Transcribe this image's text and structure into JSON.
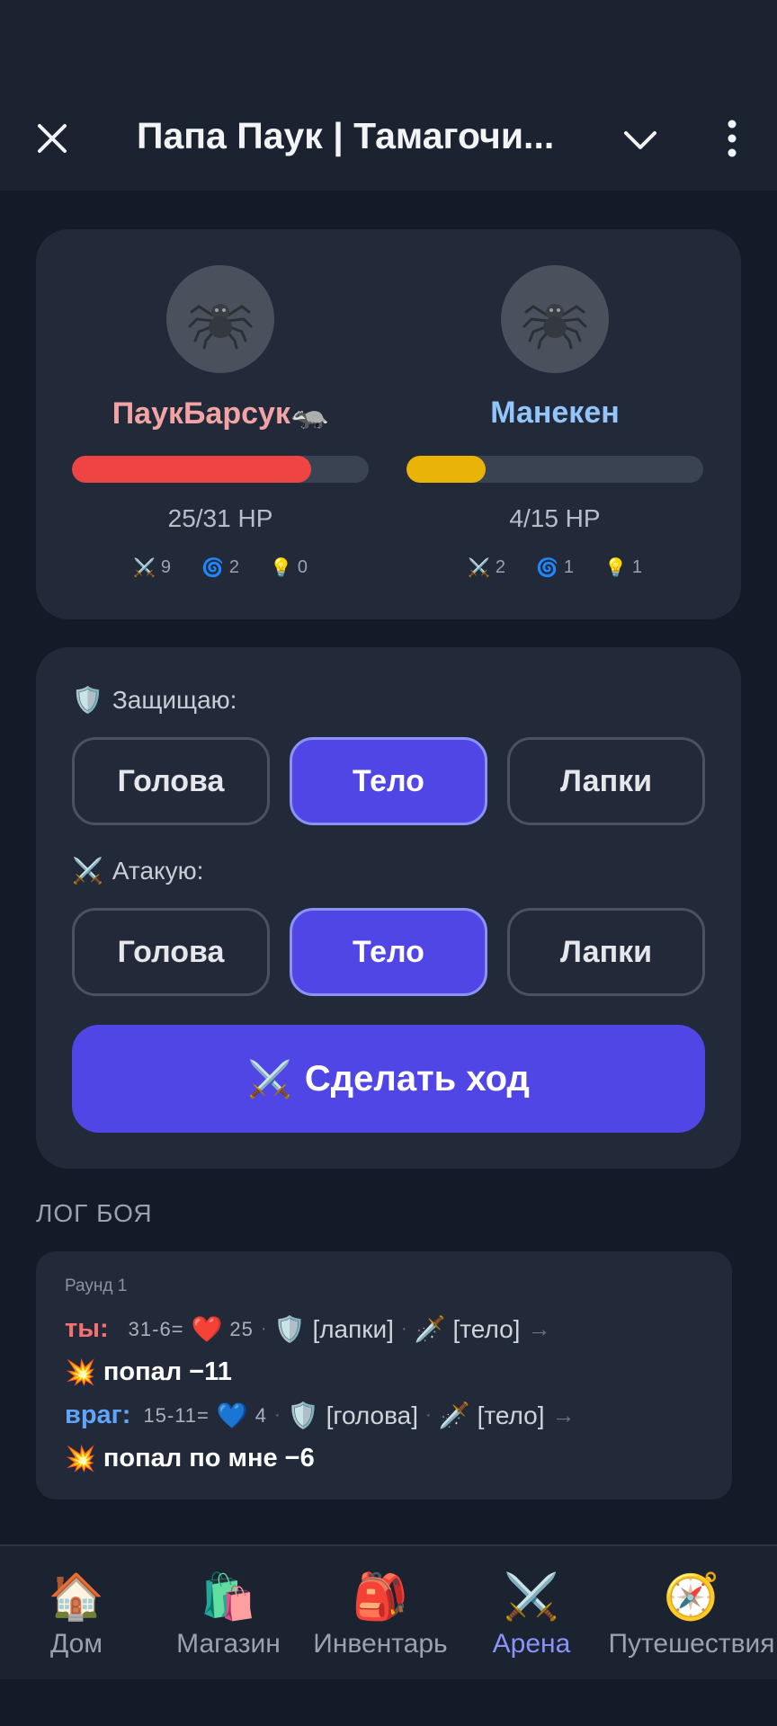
{
  "header": {
    "title": "Папа Паук | Тамагочи..."
  },
  "player": {
    "name": "ПаукБарсук🦡",
    "name_color": "#f2a3a3",
    "hp_text": "25/31 HP",
    "hp_fraction": 0.806,
    "hp_color": "#ef4444",
    "attack": "9",
    "agility": "2",
    "intellect": "0"
  },
  "enemy": {
    "name": "Манекен",
    "name_color": "#93c5fd",
    "hp_text": "4/15 HP",
    "hp_fraction": 0.267,
    "hp_color": "#eab308",
    "attack": "2",
    "agility": "1",
    "intellect": "1"
  },
  "controls": {
    "defend_label": "Защищаю:",
    "attack_label": "Атакую:",
    "defend_options": [
      "Голова",
      "Тело",
      "Лапки"
    ],
    "attack_options": [
      "Голова",
      "Тело",
      "Лапки"
    ],
    "defend_selected": "Тело",
    "attack_selected": "Тело",
    "make_move": "Сделать ход"
  },
  "log": {
    "title": "ЛОГ БОЯ",
    "round": "Раунд 1",
    "you": {
      "who": "ты:",
      "calc": "31-6=",
      "hp": "25",
      "defend": "[лапки]",
      "attack": "[тело]",
      "result": "попал −11"
    },
    "enemy": {
      "who": "враг:",
      "calc": "15-11=",
      "hp": "4",
      "defend": "[голова]",
      "attack": "[тело]",
      "result": "попал по мне −6"
    }
  },
  "nav": {
    "items": [
      {
        "label": "Дом",
        "icon": "house-icon"
      },
      {
        "label": "Магазин",
        "icon": "shopping-bags-icon"
      },
      {
        "label": "Инвентарь",
        "icon": "backpack-icon"
      },
      {
        "label": "Арена",
        "icon": "crossed-swords-icon"
      },
      {
        "label": "Путешествия",
        "icon": "compass-icon"
      }
    ],
    "active": "Арена"
  },
  "colors": {
    "accent": "#4f46e5",
    "you_label": "#f87171",
    "enemy_label": "#60a5fa"
  }
}
